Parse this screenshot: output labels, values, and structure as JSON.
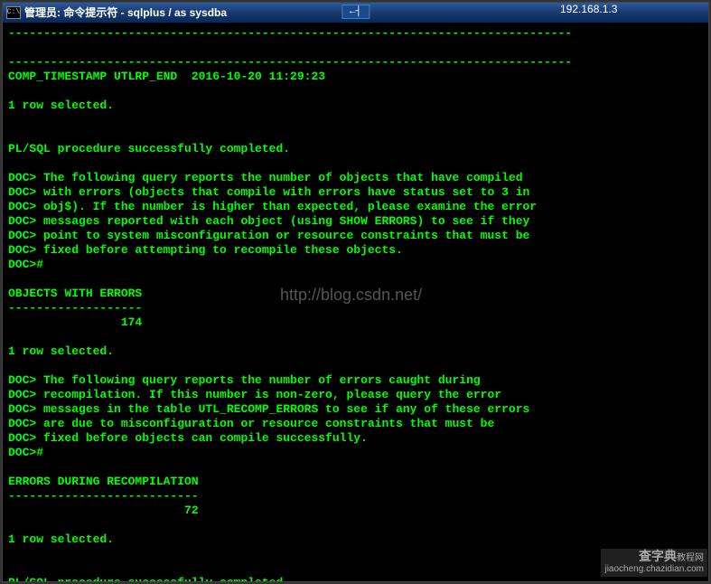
{
  "titlebar": {
    "icon_label": "C:\\",
    "text": "管理员: 命令提示符 - sqlplus  / as sysdba",
    "center_box_glyph": "←┤",
    "ip": "192.168.1.3"
  },
  "terminal": {
    "divider_top": "--------------------------------------------------------------------------------",
    "divider_sep": "--------------------------------------------------------------------------------",
    "timestamp_line": "COMP_TIMESTAMP UTLRP_END  2016-10-20 11:29:23",
    "rows_selected": "1 row selected.",
    "plsql_done": "PL/SQL procedure successfully completed.",
    "doc_block1": [
      "DOC> The following query reports the number of objects that have compiled",
      "DOC> with errors (objects that compile with errors have status set to 3 in",
      "DOC> obj$). If the number is higher than expected, please examine the error",
      "DOC> messages reported with each object (using SHOW ERRORS) to see if they",
      "DOC> point to system misconfiguration or resource constraints that must be",
      "DOC> fixed before attempting to recompile these objects.",
      "DOC>#"
    ],
    "objects_header": "OBJECTS WITH ERRORS",
    "objects_divider": "-------------------",
    "objects_value": "                174",
    "doc_block2": [
      "DOC> The following query reports the number of errors caught during",
      "DOC> recompilation. If this number is non-zero, please query the error",
      "DOC> messages in the table UTL_RECOMP_ERRORS to see if any of these errors",
      "DOC> are due to misconfiguration or resource constraints that must be",
      "DOC> fixed before objects can compile successfully.",
      "DOC>#"
    ],
    "errors_header": "ERRORS DURING RECOMPILATION",
    "errors_divider": "---------------------------",
    "errors_value": "                         72"
  },
  "watermark": {
    "center": "http://blog.csdn.net/",
    "corner_top": "查字典",
    "corner_bottom": "jiaocheng.chazidian.com",
    "corner_side": "教程网"
  }
}
